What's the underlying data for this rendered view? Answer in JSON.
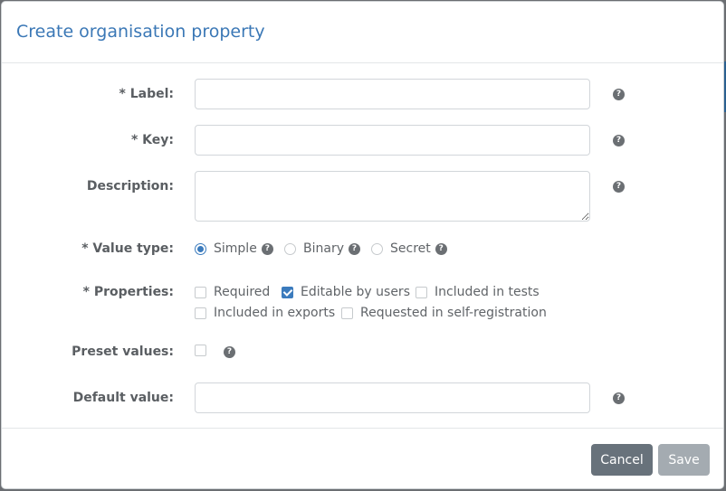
{
  "dialog": {
    "title": "Create organisation property"
  },
  "form": {
    "label": {
      "label": "* Label:",
      "value": "",
      "placeholder": ""
    },
    "key": {
      "label": "* Key:",
      "value": "",
      "placeholder": ""
    },
    "description": {
      "label": "Description:",
      "value": "",
      "placeholder": ""
    },
    "value_type": {
      "label": "* Value type:",
      "options": [
        {
          "label": "Simple",
          "selected": true
        },
        {
          "label": "Binary",
          "selected": false
        },
        {
          "label": "Secret",
          "selected": false
        }
      ]
    },
    "properties": {
      "label": "* Properties:",
      "options": [
        {
          "label": "Required",
          "checked": false
        },
        {
          "label": "Editable by users",
          "checked": true
        },
        {
          "label": "Included in tests",
          "checked": false
        },
        {
          "label": "Included in exports",
          "checked": false
        },
        {
          "label": "Requested in self-registration",
          "checked": false
        }
      ]
    },
    "preset_values": {
      "label": "Preset values:",
      "checked": false
    },
    "default_value": {
      "label": "Default value:",
      "value": "",
      "placeholder": ""
    },
    "help_glyph": "?"
  },
  "footer": {
    "cancel_label": "Cancel",
    "save_label": "Save"
  },
  "colors": {
    "accent": "#3b7bbd",
    "title": "#3b78b6",
    "cancel_button": "#68727b",
    "save_button_disabled": "#a4abb1"
  }
}
